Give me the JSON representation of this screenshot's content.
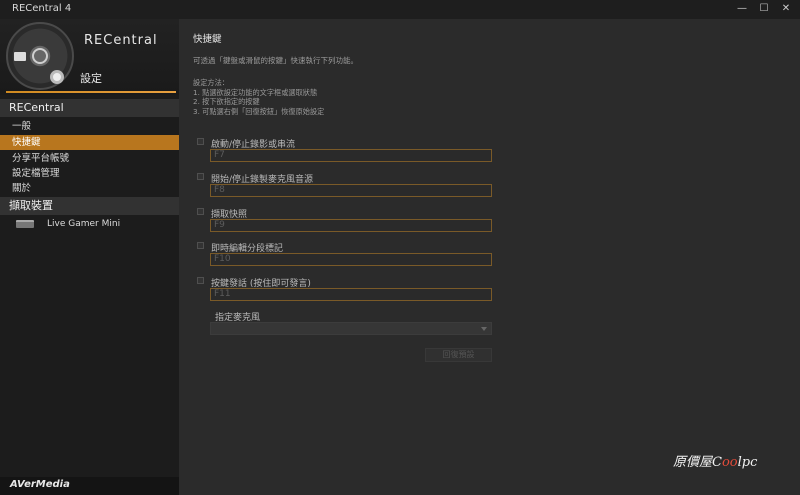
{
  "window": {
    "title": "RECentral 4",
    "buttons": [
      "—",
      "☐",
      "✕"
    ]
  },
  "brand": {
    "name": "RECentral",
    "page": "設定"
  },
  "sidebar": {
    "section1": "RECentral",
    "items": [
      {
        "label": "一般",
        "active": false
      },
      {
        "label": "快捷鍵",
        "active": true
      },
      {
        "label": "分享平台帳號",
        "active": false
      },
      {
        "label": "設定檔管理",
        "active": false
      },
      {
        "label": "關於",
        "active": false
      }
    ],
    "section2": "擷取裝置",
    "device": {
      "label": "Live Gamer Mini",
      "icon": "capture-device-icon"
    },
    "footer": "AVerMedia"
  },
  "main": {
    "heading": "快捷鍵",
    "description": "可透過「鍵盤或滑鼠的按鍵」快速執行下列功能。",
    "method_title": "設定方法：",
    "method_steps": [
      "1. 點選欲設定功能的文字框或選取狀態",
      "2. 按下欲指定的按鍵",
      "3. 可點選右側「回復按鈕」恢復原始設定"
    ],
    "options": [
      {
        "label": "啟動/停止錄影或串流",
        "value": "F7"
      },
      {
        "label": "開始/停止錄製麥克風音源",
        "value": "F8"
      },
      {
        "label": "擷取快照",
        "value": "F9"
      },
      {
        "label": "即時編輯分段標記",
        "value": "F10"
      },
      {
        "label": "按鍵發話 (按住即可發言)",
        "value": "F11"
      }
    ],
    "mic_label": "指定麥克風",
    "mic_value": "",
    "restore_button": "回復預設"
  },
  "watermark": {
    "prefix": "原價屋",
    "c": "C",
    "oo": "oo",
    "suffix": "lpc"
  }
}
